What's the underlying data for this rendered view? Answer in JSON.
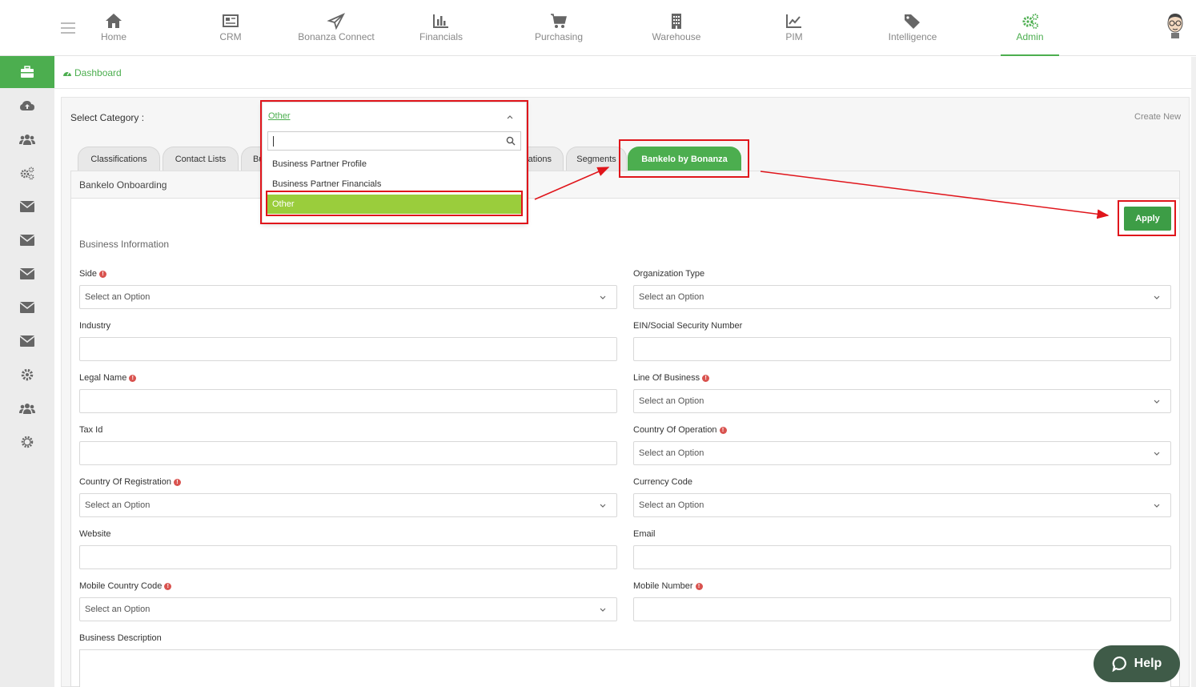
{
  "nav": {
    "items": [
      {
        "label": "Home",
        "icon": "home-icon"
      },
      {
        "label": "CRM",
        "icon": "newspaper-icon"
      },
      {
        "label": "Bonanza Connect",
        "icon": "paper-plane-icon"
      },
      {
        "label": "Financials",
        "icon": "bar-chart-icon"
      },
      {
        "label": "Purchasing",
        "icon": "cart-icon"
      },
      {
        "label": "Warehouse",
        "icon": "building-icon"
      },
      {
        "label": "PIM",
        "icon": "line-chart-icon"
      },
      {
        "label": "Intelligence",
        "icon": "tags-icon"
      },
      {
        "label": "Admin",
        "icon": "gears-icon",
        "active": true
      }
    ]
  },
  "breadcrumb": {
    "label": "Dashboard"
  },
  "category": {
    "label": "Select Category :",
    "create_new": "Create New",
    "selected": "Other",
    "search_value": "",
    "options": [
      "Business Partner Profile",
      "Business Partner Financials",
      "Other"
    ],
    "highlighted": "Other"
  },
  "tabs": [
    {
      "label": "Classifications"
    },
    {
      "label": "Contact Lists"
    },
    {
      "label": "Bu"
    },
    {
      "label": "cations"
    },
    {
      "label": "Segments"
    },
    {
      "label": "Bankelo by Bonanza",
      "active": true
    }
  ],
  "panel": {
    "title": "Bankelo Onboarding",
    "section": "Business Information",
    "apply_label": "Apply"
  },
  "form": {
    "placeholder": "Select an Option",
    "left": [
      {
        "label": "Side",
        "required": true,
        "type": "select"
      },
      {
        "label": "Industry",
        "required": false,
        "type": "text"
      },
      {
        "label": "Legal Name",
        "required": true,
        "type": "text"
      },
      {
        "label": "Tax Id",
        "required": false,
        "type": "text"
      },
      {
        "label": "Country Of Registration",
        "required": true,
        "type": "select"
      },
      {
        "label": "Website",
        "required": false,
        "type": "text"
      },
      {
        "label": "Mobile Country Code",
        "required": true,
        "type": "select"
      }
    ],
    "right": [
      {
        "label": "Organization Type",
        "required": false,
        "type": "select"
      },
      {
        "label": "EIN/Social Security Number",
        "required": false,
        "type": "text"
      },
      {
        "label": "Line Of Business",
        "required": true,
        "type": "select"
      },
      {
        "label": "Country Of Operation",
        "required": true,
        "type": "select"
      },
      {
        "label": "Currency Code",
        "required": false,
        "type": "select"
      },
      {
        "label": "Email",
        "required": false,
        "type": "text"
      },
      {
        "label": "Mobile Number",
        "required": true,
        "type": "text"
      }
    ],
    "description_label": "Business Description"
  },
  "help": {
    "label": "Help"
  },
  "colors": {
    "accent": "#4cae4f",
    "highlight": "#9acd3c",
    "annotation": "#e0151b",
    "help_bg": "#3f5b48"
  }
}
